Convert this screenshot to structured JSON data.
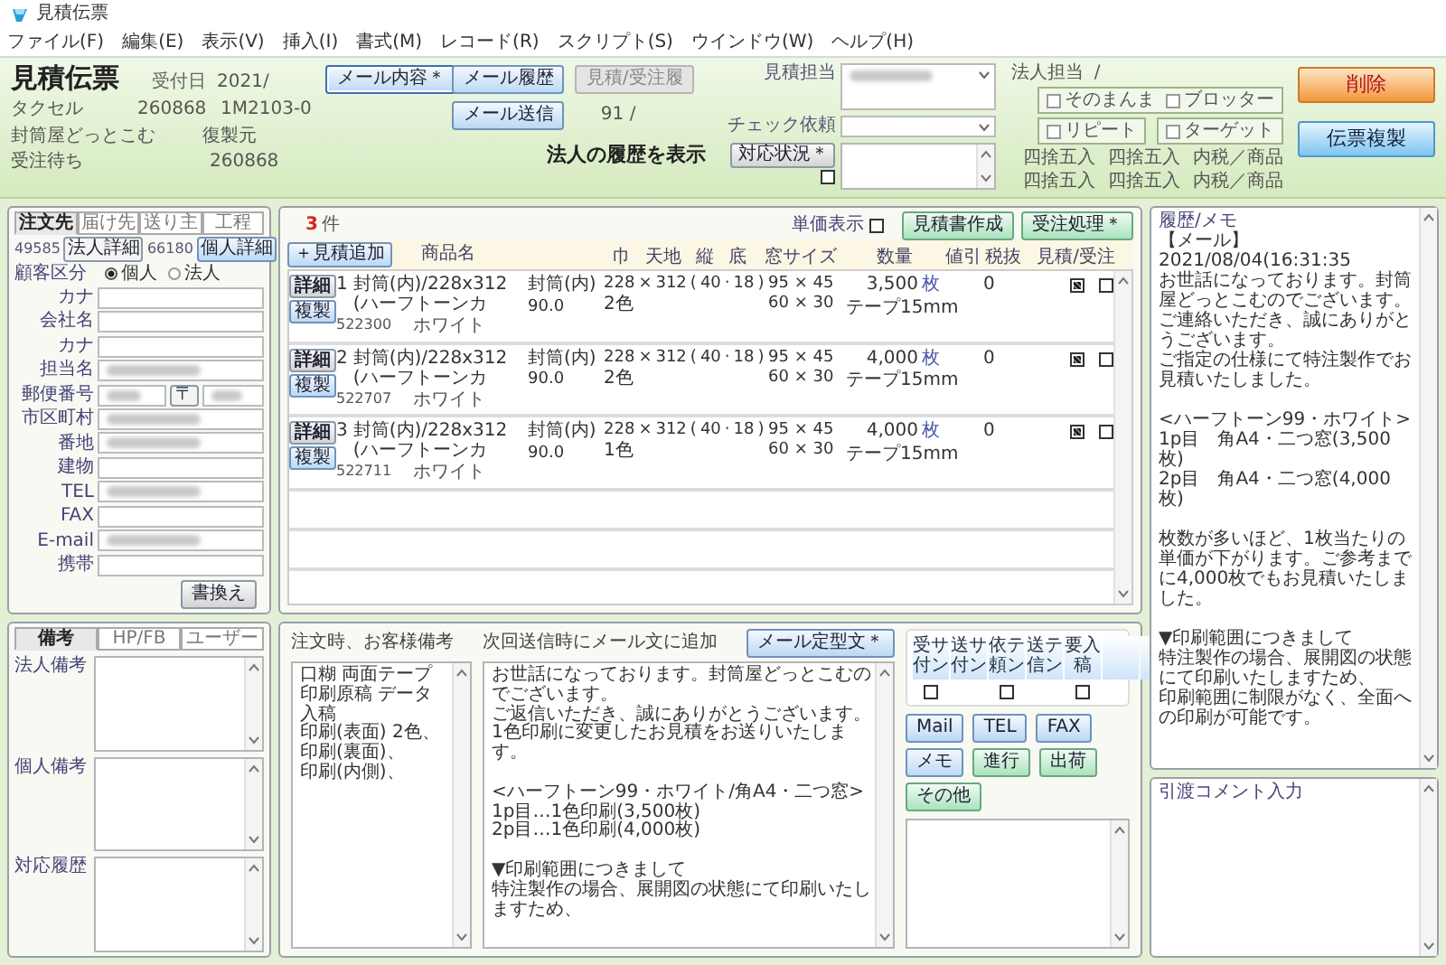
{
  "window": {
    "title": "見積伝票"
  },
  "menu": [
    "ファイル(F)",
    "編集(E)",
    "表示(V)",
    "挿入(I)",
    "書式(M)",
    "レコード(R)",
    "スクリプト(S)",
    "ウインドウ(W)",
    "ヘルプ(H)"
  ],
  "header": {
    "title": "見積伝票",
    "received_label": "受付日",
    "received_value": "2021/",
    "agent": "タクセル",
    "customer_no": "260868",
    "slip_no": "1M2103-0",
    "shop": "封筒屋どっとこむ",
    "copy_source_label": "復製元",
    "status": "受注待ち",
    "status_no": "260868",
    "buttons": [
      {
        "label": "メール内容＊",
        "kind": "menu",
        "disabled": false
      },
      {
        "label": "メール履歴",
        "kind": "plain",
        "disabled": false
      },
      {
        "label": "見積/受注履",
        "kind": "plain",
        "disabled": true
      },
      {
        "label": "メール送信",
        "kind": "plain",
        "disabled": false
      }
    ],
    "history_count": "91 /",
    "corporate_history_link": "法人の履歴を表示",
    "estimate_staff_label": "見積担当",
    "estimate_staff_redacted": true,
    "check_request_label": "チェック依頼",
    "status_button": "対応状況＊",
    "status_checked": false,
    "corporate_staff_label": "法人担当",
    "corporate_staff_value": "/",
    "flags": [
      {
        "label": "そのまんま",
        "checked": false
      },
      {
        "label": "ブロッター",
        "checked": false
      },
      {
        "label": "リピート",
        "checked": false
      },
      {
        "label": "ターゲット",
        "checked": false
      }
    ],
    "rounding_rows": [
      [
        "四捨五入",
        "四捨五入",
        "内税／商品"
      ],
      [
        "四捨五入",
        "四捨五入",
        "内税／商品"
      ]
    ],
    "delete_button": "削除",
    "duplicate_button": "伝票複製"
  },
  "customer_panel": {
    "tabs": [
      {
        "label": "注文先",
        "selected": true
      },
      {
        "label": "届け先",
        "selected": false
      },
      {
        "label": "送り主",
        "selected": false
      },
      {
        "label": "工程",
        "selected": false
      }
    ],
    "corp_no": "49585",
    "corp_detail_button": "法人詳細",
    "person_no": "66180",
    "person_detail_button": "個人詳細",
    "type_label": "顧客区分",
    "type_options": [
      {
        "label": "個人",
        "selected": true
      },
      {
        "label": "法人",
        "selected": false
      }
    ],
    "fields": [
      {
        "label": "カナ",
        "kind": "text",
        "redacted": false
      },
      {
        "label": "会社名",
        "kind": "text",
        "redacted": false
      },
      {
        "label": "カナ",
        "kind": "text",
        "redacted": false
      },
      {
        "label": "担当名",
        "kind": "text",
        "redacted": true
      },
      {
        "label": "郵便番号",
        "kind": "postal",
        "redacted": true,
        "mark": "〒"
      },
      {
        "label": "市区町村",
        "kind": "text",
        "redacted": true
      },
      {
        "label": "番地",
        "kind": "text",
        "redacted": true
      },
      {
        "label": "建物",
        "kind": "text",
        "redacted": false
      },
      {
        "label": "TEL",
        "kind": "text",
        "redacted": true
      },
      {
        "label": "FAX",
        "kind": "text",
        "redacted": false
      },
      {
        "label": "E-mail",
        "kind": "text",
        "redacted": true
      },
      {
        "label": "携帯",
        "kind": "text",
        "redacted": false
      }
    ],
    "rewrite_button": "書換え"
  },
  "items": {
    "count": "3",
    "count_unit": "件",
    "add_button": "＋見積追加",
    "price_toggle": {
      "label": "単価表示",
      "checked": false
    },
    "create_button": "見積書作成",
    "order_button": "受注処理＊",
    "columns": [
      "商品名",
      "巾",
      "天地",
      "縦",
      "底",
      "窓サイズ",
      "数量",
      "値引",
      "税抜",
      "見積/受注"
    ],
    "rows": [
      {
        "detail_button": "詳細",
        "copy_button": "複製",
        "no": "1",
        "name": "封筒(内)/228x312(ハーフトーンカ",
        "code": "522300",
        "variant": "ホワイト",
        "spec": "封筒(内)",
        "weight": "90.0",
        "print_colors": "2色",
        "size": [
          "228",
          "×",
          "312",
          "(",
          "40",
          "·",
          "18",
          ")"
        ],
        "window_1": "95 × 45",
        "window_2": "60 × 30",
        "qty": "3,500",
        "qty_unit": "枚",
        "option": "テープ15mm",
        "tax": "0",
        "estimate_checked": true,
        "order_checked": false
      },
      {
        "detail_button": "詳細",
        "copy_button": "複製",
        "no": "2",
        "name": "封筒(内)/228x312(ハーフトーンカ",
        "code": "522707",
        "variant": "ホワイト",
        "spec": "封筒(内)",
        "weight": "90.0",
        "print_colors": "2色",
        "size": [
          "228",
          "×",
          "312",
          "(",
          "40",
          "·",
          "18",
          ")"
        ],
        "window_1": "95 × 45",
        "window_2": "60 × 30",
        "qty": "4,000",
        "qty_unit": "枚",
        "option": "テープ15mm",
        "tax": "0",
        "estimate_checked": true,
        "order_checked": false
      },
      {
        "detail_button": "詳細",
        "copy_button": "複製",
        "no": "3",
        "name": "封筒(内)/228x312(ハーフトーンカ",
        "code": "522711",
        "variant": "ホワイト",
        "spec": "封筒(内)",
        "weight": "90.0",
        "print_colors": "1色",
        "size": [
          "228",
          "×",
          "312",
          "(",
          "40",
          "·",
          "18",
          ")"
        ],
        "window_1": "95 × 45",
        "window_2": "60 × 30",
        "qty": "4,000",
        "qty_unit": "枚",
        "option": "テープ15mm",
        "tax": "0",
        "estimate_checked": true,
        "order_checked": false
      }
    ]
  },
  "memo": {
    "label": "履歴/メモ",
    "blocks": [
      [
        "【メール】2021/08/04(16:31:35",
        "お世話になっております。封筒屋どっとこむのでございます。",
        "ご連絡いただき、誠にありがとうございます。",
        "ご指定の仕様にて特注製作でお見積いたしました。"
      ],
      [
        "<ハーフトーン99・ホワイト>",
        "1p目　角A4・二つ窓(3,500枚)",
        "2p目　角A4・二つ窓(4,000枚)"
      ],
      [
        "枚数が多いほど、1枚当たりの単価が下がります。ご参考までに4,000枚でもお見積いたしました。"
      ],
      [
        "▼印刷範囲につきまして",
        "特注製作の場合、展開図の状態にて印刷いたしますため、",
        "印刷範囲に制限がなく、全面への印刷が可能です。"
      ]
    ]
  },
  "notes_panel": {
    "tabs": [
      {
        "label": "備考",
        "selected": true
      },
      {
        "label": "HP/FB",
        "selected": false
      },
      {
        "label": "ユーザー",
        "selected": false
      }
    ],
    "notes": [
      {
        "label": "法人備考"
      },
      {
        "label": "個人備考"
      },
      {
        "label": "対応履歴"
      }
    ]
  },
  "order_notes": {
    "label": "注文時、お客様備考",
    "lines": [
      "口糊 両面テープ",
      "印刷原稿 データ入稿",
      "印刷(表面) 2色、",
      "印刷(裏面)、",
      "印刷(内側)、"
    ]
  },
  "mail_append": {
    "label": "次回送信時にメール文に追加",
    "button": "メール定型文＊",
    "blocks": [
      [
        "お世話になっております。封筒屋どっとこむのでございます。",
        "ご返信いただき、誠にありがとうございます。",
        "1色印刷に変更したお見積をお送りいたします。"
      ],
      [
        "<ハーフトーン99・ホワイト/角A4・二つ窓>",
        "1p目…1色印刷(3,500枚)",
        "2p目…1色印刷(4,000枚)"
      ],
      [
        "▼印刷範囲につきまして",
        "特注製作の場合、展開図の状態にて印刷いたしますため、"
      ]
    ]
  },
  "tools": {
    "flags": [
      {
        "label": "受サ付ン",
        "checked": false
      },
      {
        "label": "送サ付ン"
      },
      {
        "label": "依テ頼ン",
        "checked": false
      },
      {
        "label": "送テ信ン"
      },
      {
        "label": "要入稿",
        "checked": false
      }
    ],
    "buttons": [
      {
        "label": "Mail",
        "kind": "contact"
      },
      {
        "label": "TEL",
        "kind": "contact"
      },
      {
        "label": "FAX",
        "kind": "contact"
      },
      {
        "label": "メモ",
        "kind": "contact"
      },
      {
        "label": "進行",
        "kind": "stage"
      },
      {
        "label": "出荷",
        "kind": "stage"
      },
      {
        "label": "その他",
        "kind": "stage"
      }
    ]
  },
  "handover": {
    "label": "引渡コメント入力"
  }
}
